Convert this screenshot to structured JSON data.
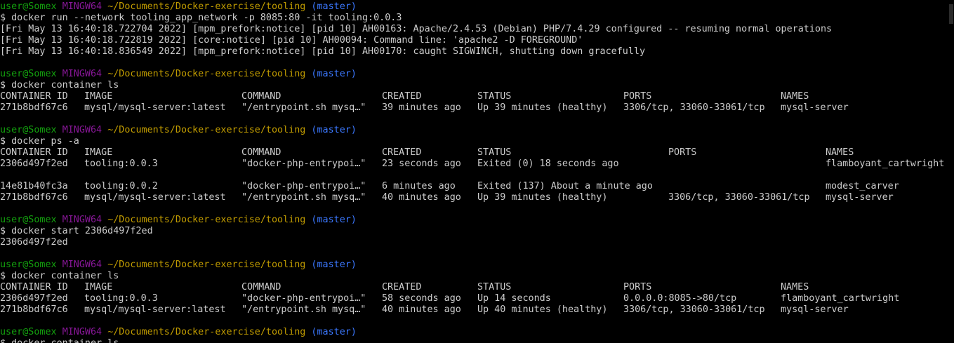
{
  "colors": {
    "background": "#000000",
    "text": "#cccccc",
    "prompt_user": "#13a10e",
    "prompt_shell": "#881798",
    "prompt_path": "#c19c00",
    "prompt_branch": "#3b78ff"
  },
  "prompt": {
    "user": "user@Somex",
    "shell": "MINGW64",
    "path": "~/Documents/Docker-exercise/tooling",
    "branch": "(master)"
  },
  "blocks": [
    {
      "command": "$ docker run --network tooling_app_network -p 8085:80 -it tooling:0.0.3",
      "output": [
        "[Fri May 13 16:40:18.722704 2022] [mpm_prefork:notice] [pid 10] AH00163: Apache/2.4.53 (Debian) PHP/7.4.29 configured -- resuming normal operations",
        "[Fri May 13 16:40:18.722819 2022] [core:notice] [pid 10] AH00094: Command line: 'apache2 -D FOREGROUND'",
        "[Fri May 13 16:40:18.836549 2022] [mpm_prefork:notice] [pid 10] AH00170: caught SIGWINCH, shutting down gracefully"
      ]
    },
    {
      "command": "$ docker container ls",
      "table": {
        "headers": [
          "CONTAINER ID",
          "IMAGE",
          "COMMAND",
          "CREATED",
          "STATUS",
          "PORTS",
          "NAMES"
        ],
        "rows": [
          [
            "271b8bdf67c6",
            "mysql/mysql-server:latest",
            "\"/entrypoint.sh mysq…\"",
            "39 minutes ago",
            "Up 39 minutes (healthy)",
            "3306/tcp, 33060-33061/tcp",
            "mysql-server"
          ]
        ]
      }
    },
    {
      "command": "$ docker ps -a",
      "table": {
        "headers": [
          "CONTAINER ID",
          "IMAGE",
          "COMMAND",
          "CREATED",
          "STATUS",
          "PORTS",
          "NAMES"
        ],
        "rows": [
          [
            "2306d497f2ed",
            "tooling:0.0.3",
            "\"docker-php-entrypoi…\"",
            "23 seconds ago",
            "Exited (0) 18 seconds ago",
            "",
            "flamboyant_cartwright"
          ],
          [
            "14e81b40fc3a",
            "tooling:0.0.2",
            "\"docker-php-entrypoi…\"",
            "6 minutes ago",
            "Exited (137) About a minute ago",
            "",
            "modest_carver"
          ],
          [
            "271b8bdf67c6",
            "mysql/mysql-server:latest",
            "\"/entrypoint.sh mysq…\"",
            "40 minutes ago",
            "Up 39 minutes (healthy)",
            "3306/tcp, 33060-33061/tcp",
            "mysql-server"
          ]
        ]
      }
    },
    {
      "command": "$ docker start 2306d497f2ed",
      "output": [
        "2306d497f2ed"
      ]
    },
    {
      "command": "$ docker container ls",
      "table": {
        "headers": [
          "CONTAINER ID",
          "IMAGE",
          "COMMAND",
          "CREATED",
          "STATUS",
          "PORTS",
          "NAMES"
        ],
        "rows": [
          [
            "2306d497f2ed",
            "tooling:0.0.3",
            "\"docker-php-entrypoi…\"",
            "58 seconds ago",
            "Up 14 seconds",
            "0.0.0.0:8085->80/tcp",
            "flamboyant_cartwright"
          ],
          [
            "271b8bdf67c6",
            "mysql/mysql-server:latest",
            "\"/entrypoint.sh mysq…\"",
            "40 minutes ago",
            "Up 40 minutes (healthy)",
            "3306/tcp, 33060-33061/tcp",
            "mysql-server"
          ]
        ]
      }
    },
    {
      "command": "$ docker container ls"
    }
  ]
}
